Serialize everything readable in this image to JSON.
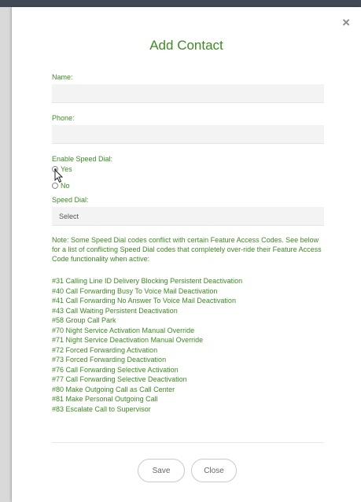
{
  "modal": {
    "close_label": "×",
    "title": "Add Contact"
  },
  "form": {
    "name_label": "Name:",
    "name_value": "",
    "phone_label": "Phone:",
    "phone_value": "",
    "speed_dial_enable_label": "Enable Speed Dial:",
    "radio_yes": "Yes",
    "radio_no": "No",
    "radio_selected": "Yes",
    "speed_dial_label": "Speed Dial:",
    "speed_dial_select": "Select"
  },
  "note": "Note: Some Speed Dial codes conflict with certain Feature Access Codes. See below for a list of conflicting Speed Dial codes that completely over-ride their Feature Access Code functionality when active:",
  "codes": [
    "#31 Calling Line ID Delivery Blocking Persistent Deactivation",
    "#40 Call Forwarding Busy To Voice Mail Deactivation",
    "#41 Call Forwarding No Answer To Voice Mail Deactivation",
    "#43 Call Waiting Persistent Deactivation",
    "#58 Group Call Park",
    "#70 Night Service Activation Manual Override",
    "#71 Night Service Deactivation Manual Override",
    "#72 Forced Forwarding Activation",
    "#73 Forced Forwarding Deactivation",
    "#76 Call Forwarding Selective Activation",
    "#77 Call Forwarding Selective Deactivation",
    "#80 Make Outgoing Call as Call Center",
    "#81 Make Personal Outgoing Call",
    "#83 Escalate Call to Supervisor"
  ],
  "buttons": {
    "save": "Save",
    "close": "Close"
  },
  "colors": {
    "accent_green": "#3a8d1f",
    "field_bg": "#f3f3f3"
  },
  "icons": {
    "close": "close-icon",
    "cursor": "mouse-pointer-icon"
  }
}
